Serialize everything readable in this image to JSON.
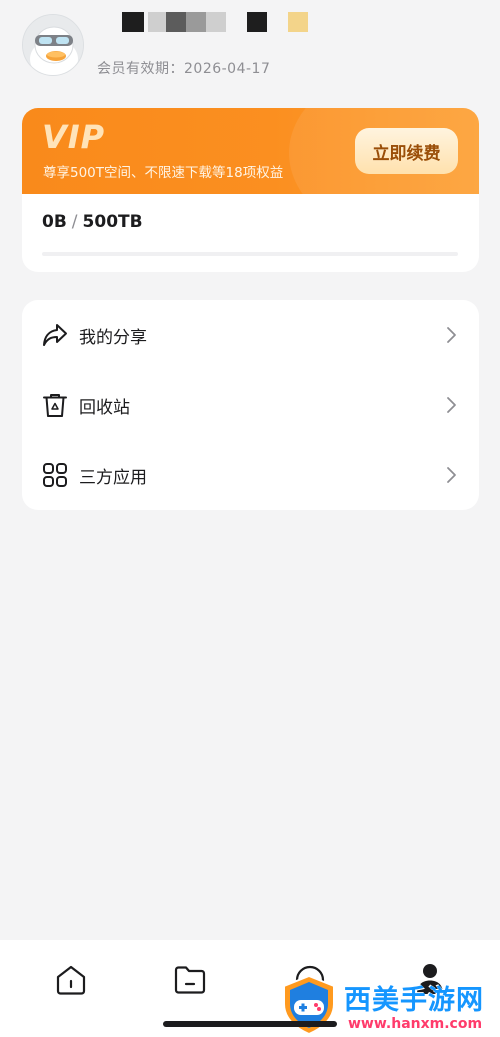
{
  "profile": {
    "avatar_icon": "duck-mascot-avatar",
    "username_masked": "■ ■■■■ ■ ■",
    "expire_label": "会员有效期：",
    "expire_date": "2026-04-17"
  },
  "vip": {
    "title": "VIP",
    "description": "尊享500T空间、不限速下载等18项权益",
    "renew_label": "立即续费",
    "storage_used": "0B",
    "storage_separator": "/",
    "storage_total": "500TB",
    "storage_used_fraction": 0,
    "accent_color": "#fb8f20"
  },
  "menu": {
    "items": [
      {
        "label": "我的分享",
        "icon": "share-icon"
      },
      {
        "label": "回收站",
        "icon": "trash-icon"
      },
      {
        "label": "三方应用",
        "icon": "apps-grid-icon"
      }
    ]
  },
  "tabbar": {
    "tabs": [
      {
        "icon": "home-icon"
      },
      {
        "icon": "folder-icon"
      },
      {
        "icon": "discover-icon"
      },
      {
        "icon": "profile-icon",
        "active": true
      }
    ]
  },
  "watermark": {
    "title": "西美手游网",
    "url": "www.hanxm.com"
  }
}
